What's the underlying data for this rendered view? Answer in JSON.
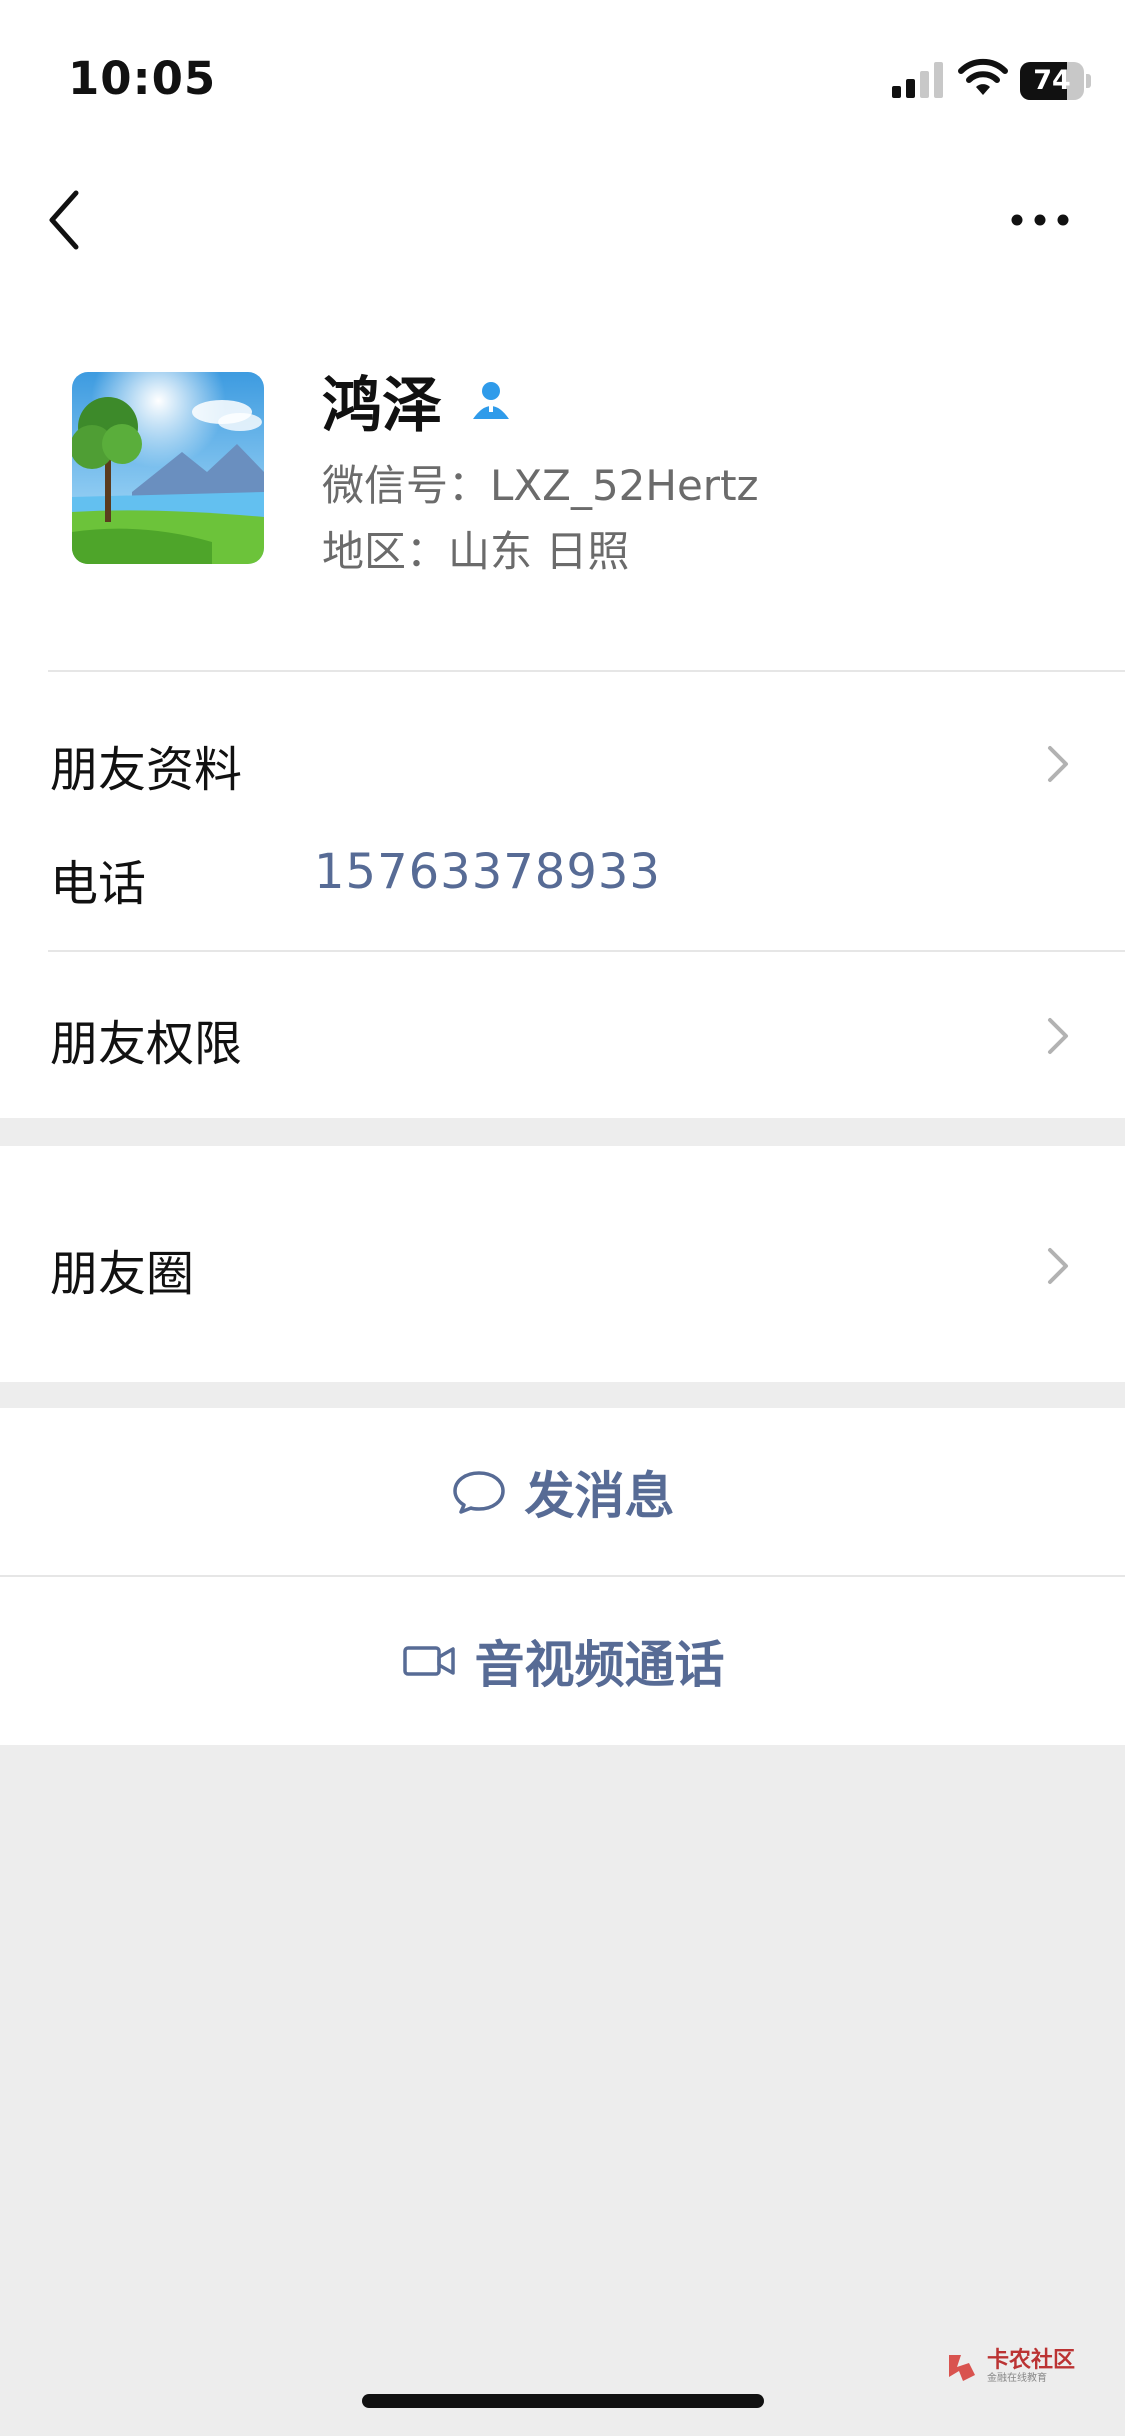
{
  "status_bar": {
    "time": "10:05",
    "battery_level": "74",
    "battery_fraction": 0.74,
    "icons": [
      "cellular-signal-icon",
      "wifi-icon",
      "battery-icon"
    ]
  },
  "nav": {
    "back_icon": "chevron-left-icon",
    "more_icon": "more-dots-icon"
  },
  "profile": {
    "avatar": "landscape-avatar-image",
    "name": "鸿泽",
    "contact_icon": "person-icon",
    "wechat_id": "微信号：LXZ_52Hertz",
    "region": "地区：山东 日照"
  },
  "info_rows": {
    "friend_profile": "朋友资料",
    "phone_label": "电话",
    "phone_value": "15763378933",
    "friend_permissions": "朋友权限",
    "moments": "朋友圈"
  },
  "actions": {
    "send_message": "发消息",
    "send_message_icon": "chat-bubble-icon",
    "video_call": "音视频通话",
    "video_call_icon": "video-camera-icon"
  },
  "watermark": {
    "title": "卡农社区",
    "subtitle": "金融在线教育"
  },
  "colors": {
    "link": "#576b95",
    "background": "#ededed",
    "accent_contact": "#2f9bea"
  }
}
